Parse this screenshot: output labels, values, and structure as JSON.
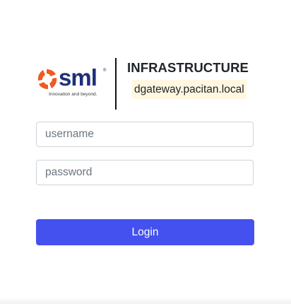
{
  "brand": {
    "logo_text": "sml",
    "logo_registered": "®",
    "logo_tagline": "Innovation and beyond.",
    "logo_icon": "sml-pinwheel-logo-icon",
    "logo_orange": "#ef5a24",
    "logo_navy": "#1f2f77"
  },
  "header": {
    "title": "INFRASTRUCTURE",
    "host": "dgateway.pacitan.local",
    "host_highlight": "#fff7e0"
  },
  "form": {
    "username": {
      "placeholder": "username",
      "value": ""
    },
    "password": {
      "placeholder": "password",
      "value": ""
    },
    "login_label": "Login",
    "login_color": "#4451ee"
  }
}
